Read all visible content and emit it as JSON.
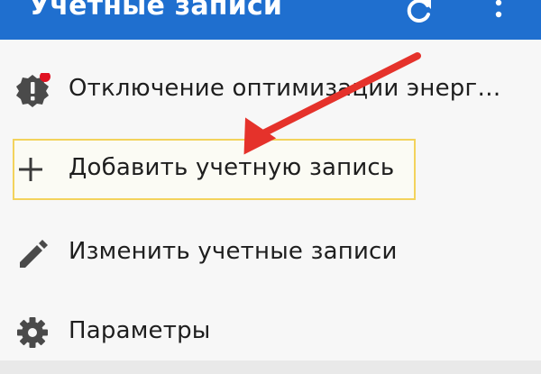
{
  "appbar": {
    "title": "Учетные записи",
    "refresh_icon": "refresh-icon",
    "more_icon": "more-vert-icon",
    "color": "#1f6fcf"
  },
  "menu": {
    "items": [
      {
        "label": "Отключение оптимизации энерго…",
        "icon": "alert-badge-icon",
        "badge_color": "#e01020"
      },
      {
        "label": "Добавить учетную запись",
        "icon": "plus-icon",
        "highlight_color": "#f3d35c"
      },
      {
        "label": "Изменить учетные записи",
        "icon": "pencil-icon"
      },
      {
        "label": "Параметры",
        "icon": "gear-icon"
      }
    ]
  },
  "annotation": {
    "icon": "red-arrow-icon",
    "color": "#e5322b"
  }
}
